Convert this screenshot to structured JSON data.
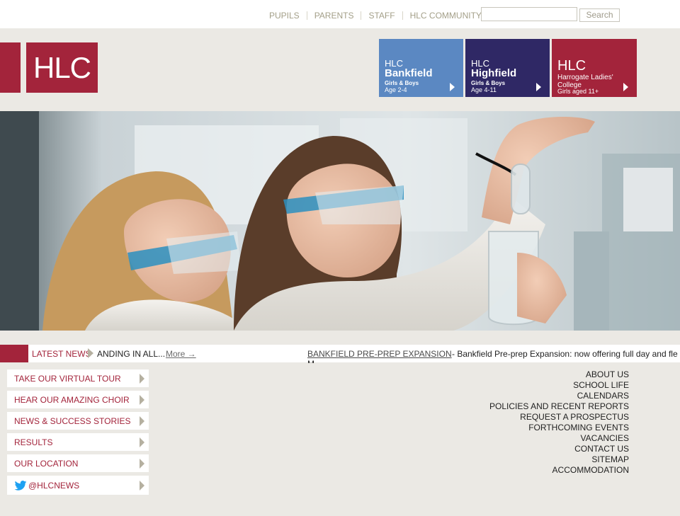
{
  "top_nav": {
    "links": [
      "PUPILS",
      "PARENTS",
      "STAFF",
      "HLC COMMUNITY"
    ],
    "search_placeholder": "",
    "search_button": "Search"
  },
  "logo": {
    "text": "HLC"
  },
  "schools": [
    {
      "prefix": "HLC",
      "name": "Bankfield",
      "sub": "Girls & Boys",
      "age": "Age 2-4",
      "color": "#5b88c2"
    },
    {
      "prefix": "HLC",
      "name": "Highfield",
      "sub": "Girls & Boys",
      "age": "Age 4-11",
      "color": "#2f2865"
    },
    {
      "prefix": "HLC",
      "name": "Harrogate Ladies' College",
      "sub": "",
      "age": "Girls aged 11+",
      "color": "#a3243b"
    }
  ],
  "news": {
    "label": "LATEST NEWS",
    "ticker_text": "ANDING IN ALL...",
    "more": "More →",
    "headline": "BANKFIELD PRE-PREP EXPANSION",
    "headline_rest": " - Bankfield Pre-prep Expansion: now offering full day and fle",
    "overflow_text": "M"
  },
  "side_buttons": [
    "TAKE OUR VIRTUAL TOUR",
    "HEAR OUR AMAZING CHOIR",
    "NEWS & SUCCESS STORIES",
    "RESULTS",
    "OUR LOCATION",
    "@HLCNEWS"
  ],
  "right_links": [
    "ABOUT US",
    "SCHOOL LIFE",
    "CALENDARS",
    "POLICIES AND RECENT REPORTS",
    "REQUEST A PROSPECTUS",
    "FORTHCOMING EVENTS",
    "VACANCIES",
    "CONTACT US",
    "SITEMAP",
    "ACCOMMODATION"
  ],
  "colors": {
    "brand": "#a3243b",
    "background": "#ebe9e4",
    "nav_text": "#a39f88"
  }
}
